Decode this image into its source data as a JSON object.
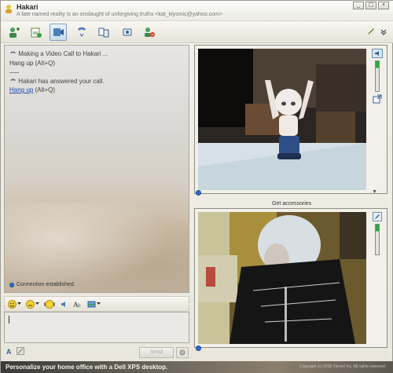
{
  "window": {
    "contact_name": "Hakari",
    "contact_status": "A fate named reality is an onslaught of unforgiving truths <kat_klysmic@yahoo.com>",
    "controls": [
      "_",
      "▢",
      "×"
    ]
  },
  "toolbar": {
    "items": [
      {
        "name": "invite-icon"
      },
      {
        "name": "send-files-icon"
      },
      {
        "name": "video-call-icon"
      },
      {
        "name": "call-icon"
      },
      {
        "name": "share-icon"
      },
      {
        "name": "games-icon"
      },
      {
        "name": "block-icon"
      }
    ]
  },
  "conversation": {
    "messages": [
      {
        "text": "Making a Video Call to Hakari ...",
        "action": "Hang up",
        "shortcut": "(Alt+Q)"
      },
      {
        "text": "Hakari has answered your call.",
        "action": "Hang up",
        "shortcut": "(Alt+Q)"
      }
    ],
    "connection_status": "Connection established."
  },
  "compose": {
    "send_label": "Send"
  },
  "video": {
    "get_accessories": "Get accessories"
  },
  "banner": {
    "text": "Personalize your home office with a Dell XPS desktop.",
    "copyright": "Copyright (c) 2006 Yahoo! Inc. All rights reserved."
  }
}
